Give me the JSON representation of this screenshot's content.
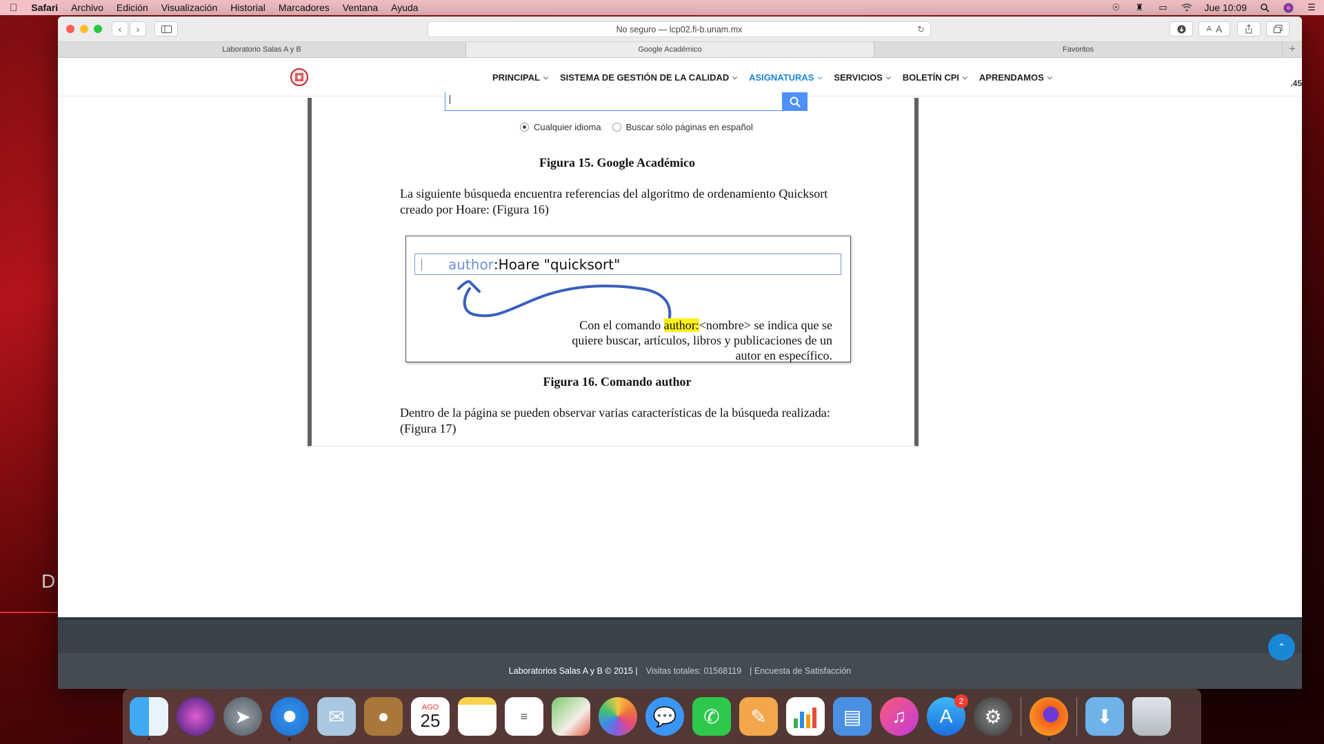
{
  "menubar": {
    "app": "Safari",
    "items": [
      "Archivo",
      "Edición",
      "Visualización",
      "Historial",
      "Marcadores",
      "Ventana",
      "Ayuda"
    ],
    "clock": "Jue 10:09"
  },
  "browser": {
    "url": "No seguro — lcp02.fi-b.unam.mx",
    "tabs": [
      "Laboratorio Salas A y B",
      "Google Académico",
      "Favoritos"
    ],
    "reader_text_small": "A",
    "reader_text_large": "A"
  },
  "site_nav": {
    "items": [
      {
        "label": "PRINCIPAL"
      },
      {
        "label": "SISTEMA DE GESTIÓN DE LA CALIDAD"
      },
      {
        "label": "ASIGNATURAS"
      },
      {
        "label": "SERVICIOS"
      },
      {
        "label": "BOLETÍN CPI"
      },
      {
        "label": "APRENDAMOS"
      }
    ],
    "side_number": ".45"
  },
  "document": {
    "radio_any": "Cualquier idioma",
    "radio_spanish": "Buscar sólo páginas en español",
    "caption15": "Figura 15. Google Académico",
    "para1": "La siguiente búsqueda encuentra referencias del algoritmo de ordenamiento Quicksort creado por Hoare: (Figura 16)",
    "fig16_keyword": "author",
    "fig16_query": ":Hoare \"quicksort\"",
    "fig16_note_pre": "Con el comando ",
    "fig16_note_hl": "author:",
    "fig16_note_post": "<nombre> se indica que se quiere buscar, artículos, libros y publicaciones de un autor en específico.",
    "caption16": "Figura 16. Comando author",
    "para2": "Dentro de la página se pueden observar varias características de la búsqueda realizada: (Figura 17)"
  },
  "footer": {
    "copyright": "Laboratorios Salas A y B © 2015 |",
    "visits": "Visitas totales: 01568119",
    "survey": "| Encuesta de Satisfacción"
  },
  "desktop": {
    "letter": "D"
  },
  "dock": {
    "calendar_month": "AGO",
    "calendar_day": "25",
    "appstore_badge": "2"
  }
}
